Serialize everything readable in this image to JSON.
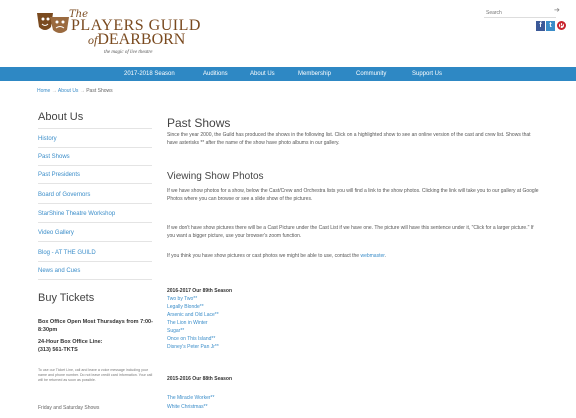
{
  "logo": {
    "the": "The",
    "line1": "PLAYERS GUILD",
    "of": "of",
    "line2": "DEARBORN",
    "tagline": "the magic of live theatre"
  },
  "search": {
    "placeholder": "Search"
  },
  "social": {
    "facebook": "f",
    "twitter": "t",
    "pinterest": "p"
  },
  "nav": [
    "2017-2018 Season",
    "Auditions",
    "About Us",
    "Membership",
    "Community",
    "Support Us"
  ],
  "breadcrumb": {
    "home": "Home",
    "sep": "→",
    "about": "About Us",
    "current": "Past Shows"
  },
  "sidebar": {
    "heading": "About Us",
    "links": [
      "History",
      "Past Shows",
      "Past Presidents",
      "Board of Governors",
      "StarShine Theatre Workshop",
      "Video Gallery",
      "Blog - AT THE GUILD",
      "News and Cues"
    ],
    "tickets_heading": "Buy Tickets",
    "box_office": "Box Office Open Most Thursdays from 7:00-8:30pm",
    "phone_label": "24-Hour Box Office Line:",
    "phone": "(313) 561-TKTS",
    "note": "To use our Ticket Line, call and leave a voice message including your name and phone number. Do not leave credit card information. Your call will be returned as soon as possible.",
    "friday": "Friday and Saturday Shows"
  },
  "main": {
    "title": "Past Shows",
    "intro": "Since the year 2000, the Guild has produced the shows in the following list. Click on a highlighted show to see an online version of the cast and crew list. Shows that have asterisks ** after the name of the show have photo albums in our gallery.",
    "photos_heading": "Viewing Show Photos",
    "para1": "If we have show photos for a show, below the Cast/Crew and Orchestra lists you will find a link to the show photos. Clicking the link will take you to our gallery at Google Photos where you can browse or see a slide show of the pictures.",
    "para2": "If we don't have show pictures there will be a Cast Picture under the Cast List if we have one. The picture will have this sentence under it, \"Click for a larger picture.\" If you want a bigger picture, use your browser's zoom function.",
    "para3_pre": "If you think you have show pictures or cast photos we might be able to use, contact the ",
    "para3_link": "webmaster",
    "para3_post": ".",
    "season1": "2016-2017 Our 89th Season",
    "shows1": [
      "Two by Two**",
      "Legally Blonde**",
      "Arsenic and Old Lace**",
      "The Lion in Winter",
      "Sugar**",
      "Once on This Island**",
      "Disney's Peter Pan Jr**"
    ],
    "season2": "2015-2016 Our 88th Season",
    "shows2": [
      "The Miracle Worker**",
      "White Christmas**"
    ]
  }
}
